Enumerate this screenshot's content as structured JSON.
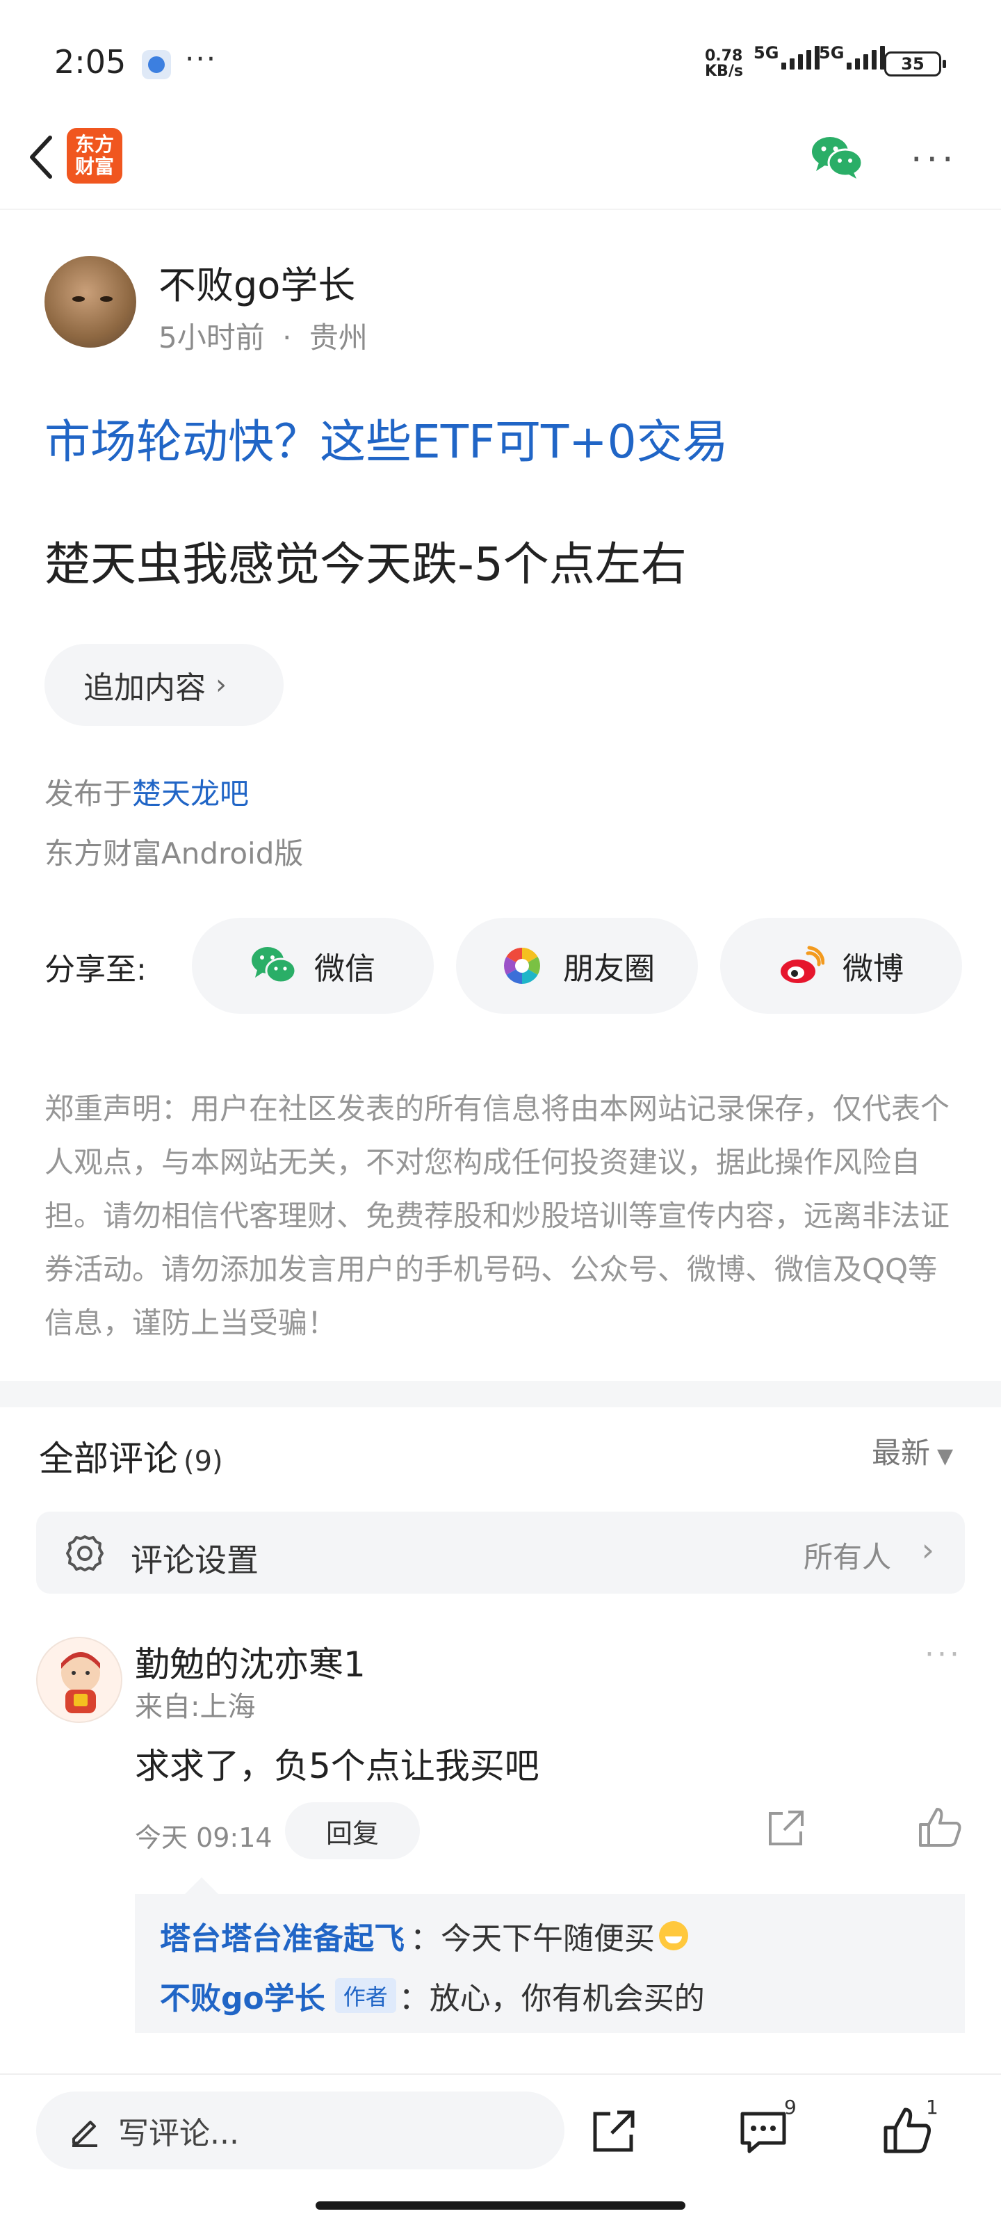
{
  "status_bar": {
    "time": "2:05",
    "more": "···",
    "net_speed_value": "0.78",
    "net_speed_unit": "KB/s",
    "network_1": "5G",
    "network_2": "5G",
    "battery": "35"
  },
  "header": {
    "logo_text_line1": "东方",
    "logo_text_line2": "财富",
    "logo_color": "#f0561f",
    "more": "···"
  },
  "post": {
    "author_name": "不败go学长",
    "time_ago": "5小时前",
    "separator": "·",
    "location": "贵州",
    "title_link": "市场轮动快？这些ETF可T+0交易",
    "body": "楚天虫我感觉今天跌-5个点左右",
    "append_label": "追加内容",
    "published_prefix": "发布于",
    "published_bar": "楚天龙吧",
    "client": "东方财富Android版"
  },
  "share": {
    "label": "分享至:",
    "wechat": "微信",
    "moments": "朋友圈",
    "weibo": "微博"
  },
  "disclaimer": "郑重声明：用户在社区发表的所有信息将由本网站记录保存，仅代表个人观点，与本网站无关，不对您构成任何投资建议，据此操作风险自担。请勿相信代客理财、免费荐股和炒股培训等宣传内容，远离非法证券活动。请勿添加发言用户的手机号码、公众号、微博、微信及QQ等信息，谨防上当受骗！",
  "comments": {
    "title": "全部评论",
    "count": "(9)",
    "sort": "最新",
    "settings_label": "评论设置",
    "settings_value": "所有人",
    "items": [
      {
        "name": "勤勉的沈亦寒1",
        "from": "来自:上海",
        "text": "求求了，负5个点让我买吧",
        "time": "今天 09:14",
        "reply_label": "回复",
        "replies": [
          {
            "user": "塔台塔台准备起飞",
            "text": "：今天下午随便买"
          },
          {
            "user": "不败go学长",
            "tag": "作者",
            "text": "：放心，你有机会买的"
          }
        ]
      }
    ]
  },
  "bottom_bar": {
    "write_placeholder": "写评论...",
    "comment_count": "9",
    "like_count": "1"
  },
  "colors": {
    "link_blue": "#2065c6",
    "wechat_green": "#2aae67",
    "weibo_red": "#e6162d",
    "pill_bg": "#f4f5f7"
  }
}
